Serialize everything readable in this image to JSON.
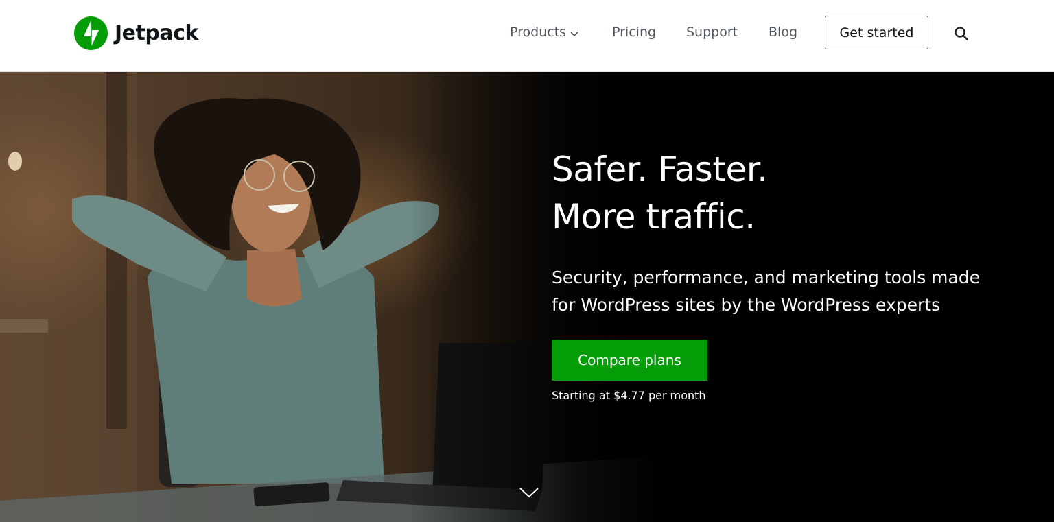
{
  "brand": {
    "name": "Jetpack",
    "color": "#069e08",
    "icon": "bolt-logo-icon"
  },
  "nav": {
    "products": "Products",
    "pricing": "Pricing",
    "support": "Support",
    "blog": "Blog",
    "get_started": "Get started",
    "search_icon": "search-icon",
    "dropdown_icon": "chevron-down-icon"
  },
  "hero": {
    "headline_line1": "Safer. Faster.",
    "headline_line2": "More traffic.",
    "subtext": "Security, performance, and marketing tools made for WordPress sites by the WordPress experts",
    "cta_label": "Compare plans",
    "cta_color": "#069e08",
    "price_note": "Starting at $4.77 per month",
    "scroll_icon": "chevron-down-icon"
  }
}
